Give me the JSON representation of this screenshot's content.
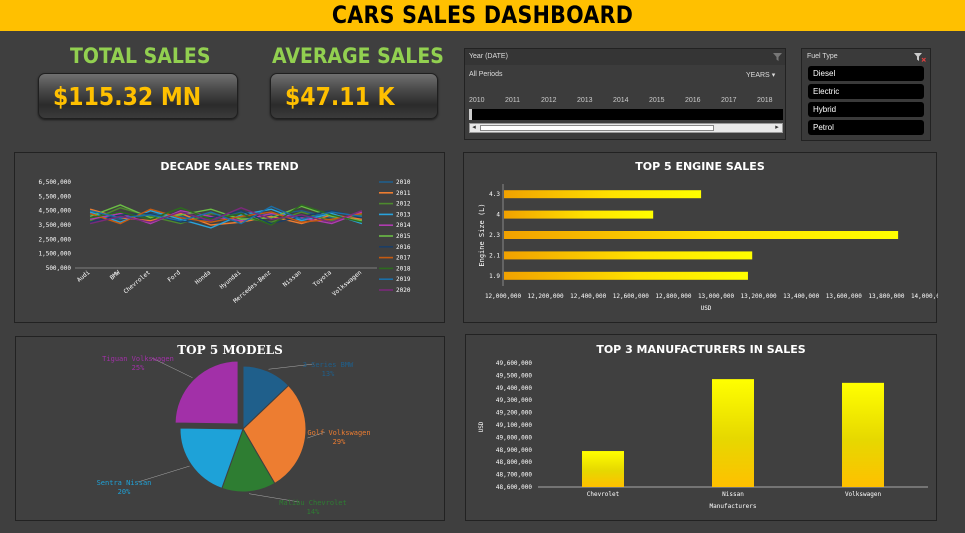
{
  "header": {
    "title": "CARS SALES DASHBOARD"
  },
  "kpis": {
    "total_label": "TOTAL SALES",
    "total_value": "$115.32 MN",
    "avg_label": "AVERAGE SALES",
    "avg_value": "$47.11 K"
  },
  "timeline": {
    "title": "Year (DATE)",
    "period": "All Periods",
    "level": "YEARS",
    "years": [
      "2010",
      "2011",
      "2012",
      "2013",
      "2014",
      "2015",
      "2016",
      "2017",
      "2018"
    ],
    "filter_icon": "filter-icon"
  },
  "fuel_slicer": {
    "title": "Fuel Type",
    "items": [
      "Diesel",
      "Electric",
      "Hybrid",
      "Petrol"
    ],
    "clear_icon": "clear-filter-icon"
  },
  "colors": {
    "accent": "#ffc000",
    "kpi_label": "#92d050",
    "background": "#3f3f3f"
  },
  "chart_data": [
    {
      "type": "line",
      "title": "DECADE SALES TREND",
      "categories": [
        "Audi",
        "BMW",
        "Chevrolet",
        "Ford",
        "Honda",
        "Hyundai",
        "Mercedes-Benz",
        "Nissan",
        "Toyota",
        "Volkswagen"
      ],
      "yticks": [
        "500,000",
        "1,500,000",
        "2,500,000",
        "3,500,000",
        "4,500,000",
        "5,500,000",
        "6,500,000"
      ],
      "ylim": [
        500000,
        6500000
      ],
      "series": [
        {
          "name": "2010",
          "color": "#1f5f8b",
          "values": [
            4200000,
            3900000,
            4300000,
            4100000,
            3800000,
            4400000,
            4200000,
            4500000,
            4000000,
            4100000
          ]
        },
        {
          "name": "2011",
          "color": "#ed7d31",
          "values": [
            4600000,
            4000000,
            3800000,
            4300000,
            3500000,
            3700000,
            4100000,
            3600000,
            4200000,
            3900000
          ]
        },
        {
          "name": "2012",
          "color": "#4d8a2e",
          "values": [
            3800000,
            4700000,
            4100000,
            3600000,
            4300000,
            4000000,
            3700000,
            4400000,
            3800000,
            4200000
          ]
        },
        {
          "name": "2013",
          "color": "#29a3dc",
          "values": [
            4400000,
            3700000,
            4500000,
            3900000,
            3300000,
            4200000,
            4600000,
            3800000,
            4300000,
            3600000
          ]
        },
        {
          "name": "2014",
          "color": "#b03cb0",
          "values": [
            3900000,
            4300000,
            3600000,
            4500000,
            4100000,
            3800000,
            4300000,
            4000000,
            3600000,
            4400000
          ]
        },
        {
          "name": "2015",
          "color": "#6bbd45",
          "values": [
            4100000,
            4900000,
            4000000,
            4200000,
            4600000,
            3900000,
            4000000,
            4800000,
            4100000,
            3800000
          ]
        },
        {
          "name": "2016",
          "color": "#1b3e66",
          "values": [
            3700000,
            4200000,
            4300000,
            3700000,
            4000000,
            4500000,
            3600000,
            4100000,
            4500000,
            4000000
          ]
        },
        {
          "name": "2017",
          "color": "#c55a11",
          "values": [
            4300000,
            3600000,
            4600000,
            4000000,
            3700000,
            4100000,
            4400000,
            3700000,
            3900000,
            4300000
          ]
        },
        {
          "name": "2018",
          "color": "#2d6b1f",
          "values": [
            4000000,
            4400000,
            3900000,
            4700000,
            3900000,
            4300000,
            3500000,
            4900000,
            4200000,
            3700000
          ]
        },
        {
          "name": "2019",
          "color": "#1a6fa8",
          "values": [
            4500000,
            4000000,
            4200000,
            3800000,
            4400000,
            3600000,
            4800000,
            3900000,
            4400000,
            4100000
          ]
        },
        {
          "name": "2020",
          "color": "#7a2a7a",
          "values": [
            3600000,
            4100000,
            3700000,
            4400000,
            3800000,
            4700000,
            3900000,
            4200000,
            3700000,
            4500000
          ]
        }
      ]
    },
    {
      "type": "bar",
      "title": "TOP 5 ENGINE SALES",
      "orientation": "horizontal",
      "categories": [
        "4.3",
        "4",
        "2.3",
        "2.1",
        "1.9"
      ],
      "values": [
        12930000,
        12705000,
        13855000,
        13170000,
        13150000
      ],
      "xlim": [
        12000000,
        14000000
      ],
      "xticks": [
        "12,000,000",
        "12,200,000",
        "12,400,000",
        "12,600,000",
        "12,800,000",
        "13,000,000",
        "13,200,000",
        "13,400,000",
        "13,600,000",
        "13,800,000",
        "14,000,000"
      ],
      "xlabel": "USD",
      "ylabel": "Engine Size (L)"
    },
    {
      "type": "pie",
      "title": "TOP 5 MODELS",
      "slices": [
        {
          "label": "3 Series BMW",
          "value": 13,
          "pct": "13%",
          "color": "#1f5f8b"
        },
        {
          "label": "Golf Volkswagen",
          "value": 29,
          "pct": "29%",
          "color": "#ed7d31"
        },
        {
          "label": "Malibu Chevrolet",
          "value": 14,
          "pct": "14%",
          "color": "#2e7d32"
        },
        {
          "label": "Sentra Nissan",
          "value": 20,
          "pct": "20%",
          "color": "#1ea2d8"
        },
        {
          "label": "Tiguan Volkswagen",
          "value": 25,
          "pct": "25%",
          "color": "#a230a8"
        }
      ]
    },
    {
      "type": "bar",
      "title": "TOP  3  MANUFACTURERS IN SALES",
      "categories": [
        "Chevrolet",
        "Nissan",
        "Volkswagen"
      ],
      "values": [
        48890000,
        49470000,
        49440000
      ],
      "ylim": [
        48600000,
        49600000
      ],
      "yticks": [
        "48,600,000",
        "48,700,000",
        "48,800,000",
        "48,900,000",
        "49,000,000",
        "49,100,000",
        "49,200,000",
        "49,300,000",
        "49,400,000",
        "49,500,000",
        "49,600,000"
      ],
      "xlabel": "Manufacturers",
      "ylabel": "USD"
    }
  ]
}
